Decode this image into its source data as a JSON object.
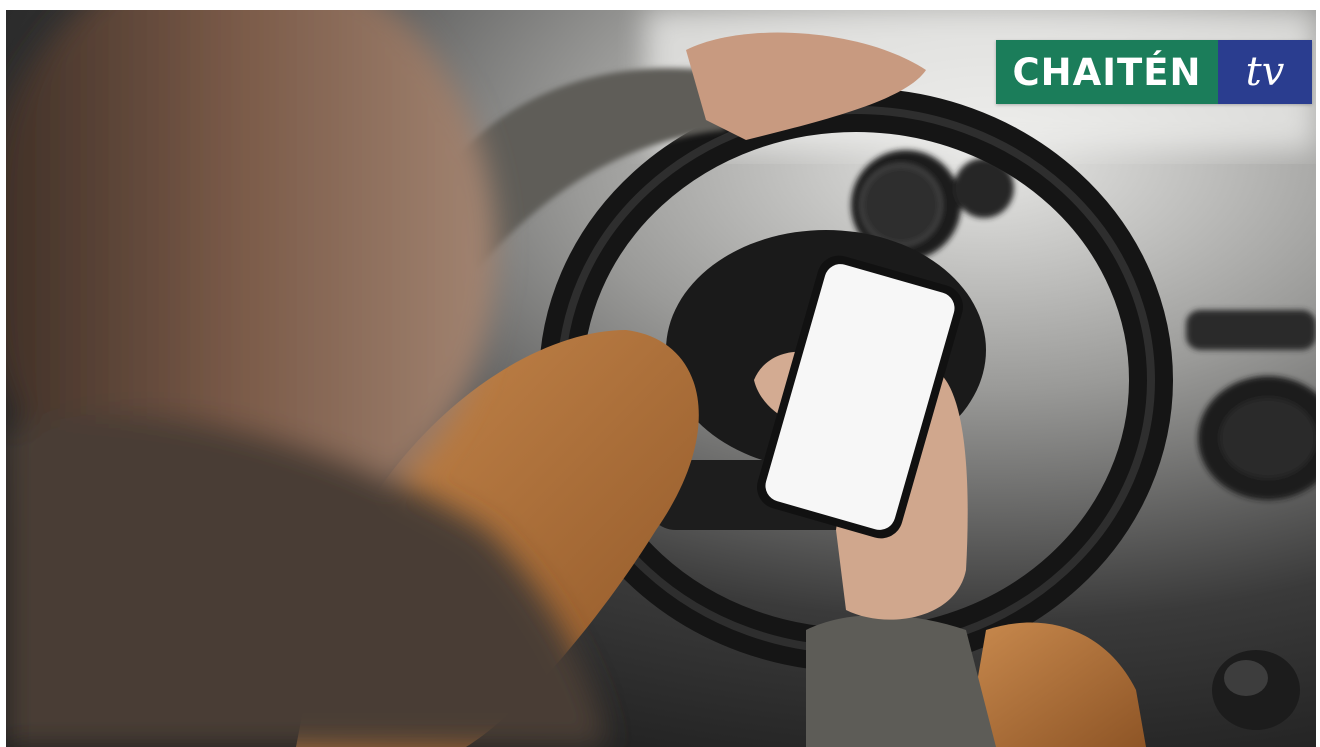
{
  "logo": {
    "brand": "CHAITÉN",
    "suffix": "tv",
    "green": "#1b7d5a",
    "blue": "#2a3d8f"
  },
  "photo": {
    "subject": "person-driving-holding-phone"
  }
}
